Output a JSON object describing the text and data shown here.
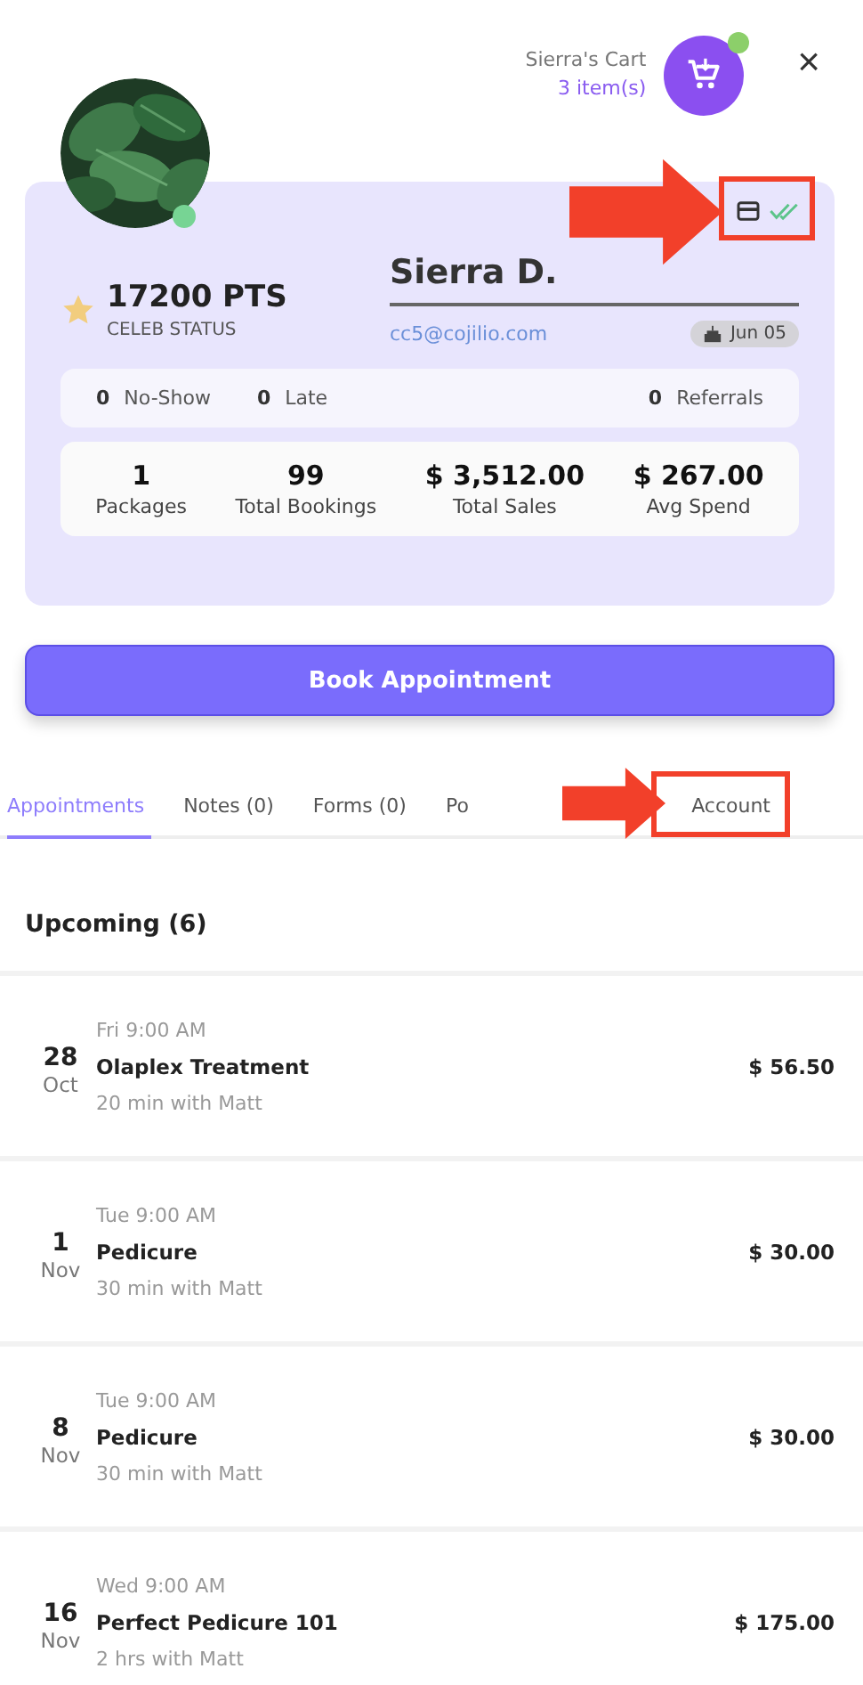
{
  "cart": {
    "title": "Sierra's Cart",
    "count": "3 item(s)",
    "online": true
  },
  "close": "×",
  "profile": {
    "online": true,
    "points": "17200 PTS",
    "status": "CELEB STATUS",
    "name": "Sierra D.",
    "email": "cc5@cojilio.com",
    "birthday": "Jun 05",
    "card_on_file": true,
    "verified": true
  },
  "counts": [
    {
      "value": "0",
      "label": "No-Show"
    },
    {
      "value": "0",
      "label": "Late"
    },
    {
      "value": "0",
      "label": "Referrals"
    }
  ],
  "stats": [
    {
      "value": "1",
      "label": "Packages"
    },
    {
      "value": "99",
      "label": "Total Bookings"
    },
    {
      "value": "$ 3,512.00",
      "label": "Total Sales"
    },
    {
      "value": "$ 267.00",
      "label": "Avg Spend"
    }
  ],
  "book_button": "Book Appointment",
  "tabs": [
    {
      "label": "Appointments",
      "selected": true
    },
    {
      "label": "Notes (0)",
      "selected": false
    },
    {
      "label": "Forms (0)",
      "selected": false
    },
    {
      "label": "Po",
      "selected": false
    },
    {
      "label": "Account",
      "selected": false
    }
  ],
  "section_title": "Upcoming (6)",
  "appointments": [
    {
      "day": "28",
      "month": "Oct",
      "time": "Fri 9:00 AM",
      "service": "Olaplex Treatment",
      "detail": "20 min with Matt",
      "price": "$ 56.50"
    },
    {
      "day": "1",
      "month": "Nov",
      "time": "Tue 9:00 AM",
      "service": "Pedicure",
      "detail": "30 min with Matt",
      "price": "$ 30.00"
    },
    {
      "day": "8",
      "month": "Nov",
      "time": "Tue 9:00 AM",
      "service": "Pedicure",
      "detail": "30 min with Matt",
      "price": "$ 30.00"
    },
    {
      "day": "16",
      "month": "Nov",
      "time": "Wed 9:00 AM",
      "service": "Perfect Pedicure 101",
      "detail": "2 hrs with Matt",
      "price": "$ 175.00"
    }
  ]
}
